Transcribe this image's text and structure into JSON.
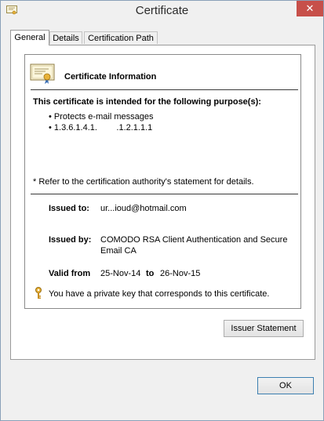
{
  "window": {
    "title": "Certificate",
    "close_label": "✕"
  },
  "tabs": [
    {
      "label": "General",
      "active": true
    },
    {
      "label": "Details",
      "active": false
    },
    {
      "label": "Certification Path",
      "active": false
    }
  ],
  "cert": {
    "info_title": "Certificate Information",
    "purpose_heading": "This certificate is intended for the following purpose(s):",
    "purposes": [
      "• Protects e-mail messages",
      "• 1.3.6.1.4.1.        .1.2.1.1.1"
    ],
    "footnote": "* Refer to the certification authority's statement for details.",
    "issued_to_label": "Issued to:",
    "issued_to_value": "ur...ioud@hotmail.com",
    "issued_by_label": "Issued by:",
    "issued_by_value_line1": "COMODO RSA Client Authentication and Secure",
    "issued_by_value_line2": "Email CA",
    "valid_from_label": "Valid from",
    "valid_from_value": "25-Nov-14",
    "valid_to_label": "to",
    "valid_to_value": "26-Nov-15",
    "private_key_text": "You have a private key that corresponds to this certificate."
  },
  "buttons": {
    "issuer_statement": "Issuer Statement",
    "ok": "OK"
  },
  "colors": {
    "close_button": "#c7504a",
    "default_button_border": "#3c7fb1"
  },
  "icons": {
    "title": "certificate-icon",
    "cert": "certificate-ribbon-icon",
    "key": "key-icon"
  }
}
